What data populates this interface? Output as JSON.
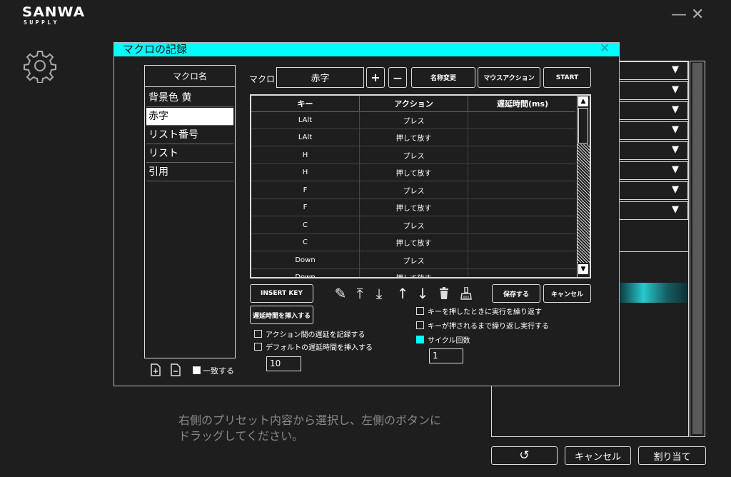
{
  "app": {
    "logo_main": "SANWA",
    "logo_sub": "SUPPLY",
    "minimize_glyph": "—",
    "close_glyph": "✕",
    "settings_icon": "gear-icon"
  },
  "background": {
    "hint_line1": "右側のプリセット内容から選択し、左側のボタンに",
    "hint_line2": "ドラッグしてください。",
    "undo_glyph": "↺",
    "cancel_label": "キャンセル",
    "assign_label": "割り当て",
    "dropdown_arrow": "▼"
  },
  "dialog": {
    "title": "マクロの記録",
    "close_glyph": "✕",
    "macro_list_header": "マクロ名",
    "macro_items": [
      "背景色 黄",
      "赤字",
      "リスト番号",
      "リスト",
      "引用"
    ],
    "selected_macro_index": 1,
    "macro_label": "マクロ",
    "macro_name_value": "赤字",
    "add_glyph": "+",
    "remove_glyph": "—",
    "rename_label": "名称変更",
    "mouse_action_label": "マウスアクション",
    "start_label": "START",
    "table": {
      "headers": [
        "キー",
        "アクション",
        "遅延時間(ms)"
      ],
      "rows": [
        {
          "key": "LAlt",
          "action": "プレス",
          "delay": ""
        },
        {
          "key": "LAlt",
          "action": "押して放す",
          "delay": ""
        },
        {
          "key": "H",
          "action": "プレス",
          "delay": ""
        },
        {
          "key": "H",
          "action": "押して放す",
          "delay": ""
        },
        {
          "key": "F",
          "action": "プレス",
          "delay": ""
        },
        {
          "key": "F",
          "action": "押して放す",
          "delay": ""
        },
        {
          "key": "C",
          "action": "プレス",
          "delay": ""
        },
        {
          "key": "C",
          "action": "押して放す",
          "delay": ""
        },
        {
          "key": "Down",
          "action": "プレス",
          "delay": ""
        },
        {
          "key": "Down",
          "action": "押して放す",
          "delay": ""
        }
      ],
      "scroll_up_glyph": "▲",
      "scroll_down_glyph": "▼"
    },
    "insert_key_label": "INSERT KEY",
    "insert_delay_label": "遅延時間を挿入する",
    "save_label": "保存する",
    "cancel_label": "キャンセル",
    "record_delay_label": "アクション間の遅延を記録する",
    "default_delay_label": "デフォルトの遅延時間を挿入する",
    "default_delay_value": "10",
    "match_label": "一致する",
    "repeat_while_pressed_label": "キーを押したときに実行を繰り返す",
    "repeat_until_pressed_label": "キーが押されるまで繰り返し実行する",
    "cycle_label": "サイクル回数",
    "cycle_value": "1",
    "tools": {
      "edit": "✎",
      "move_top": "⤒",
      "move_bottom": "⤓",
      "move_up": "↑",
      "move_down": "↓",
      "delete": "🗑",
      "clear": "⌫"
    }
  }
}
